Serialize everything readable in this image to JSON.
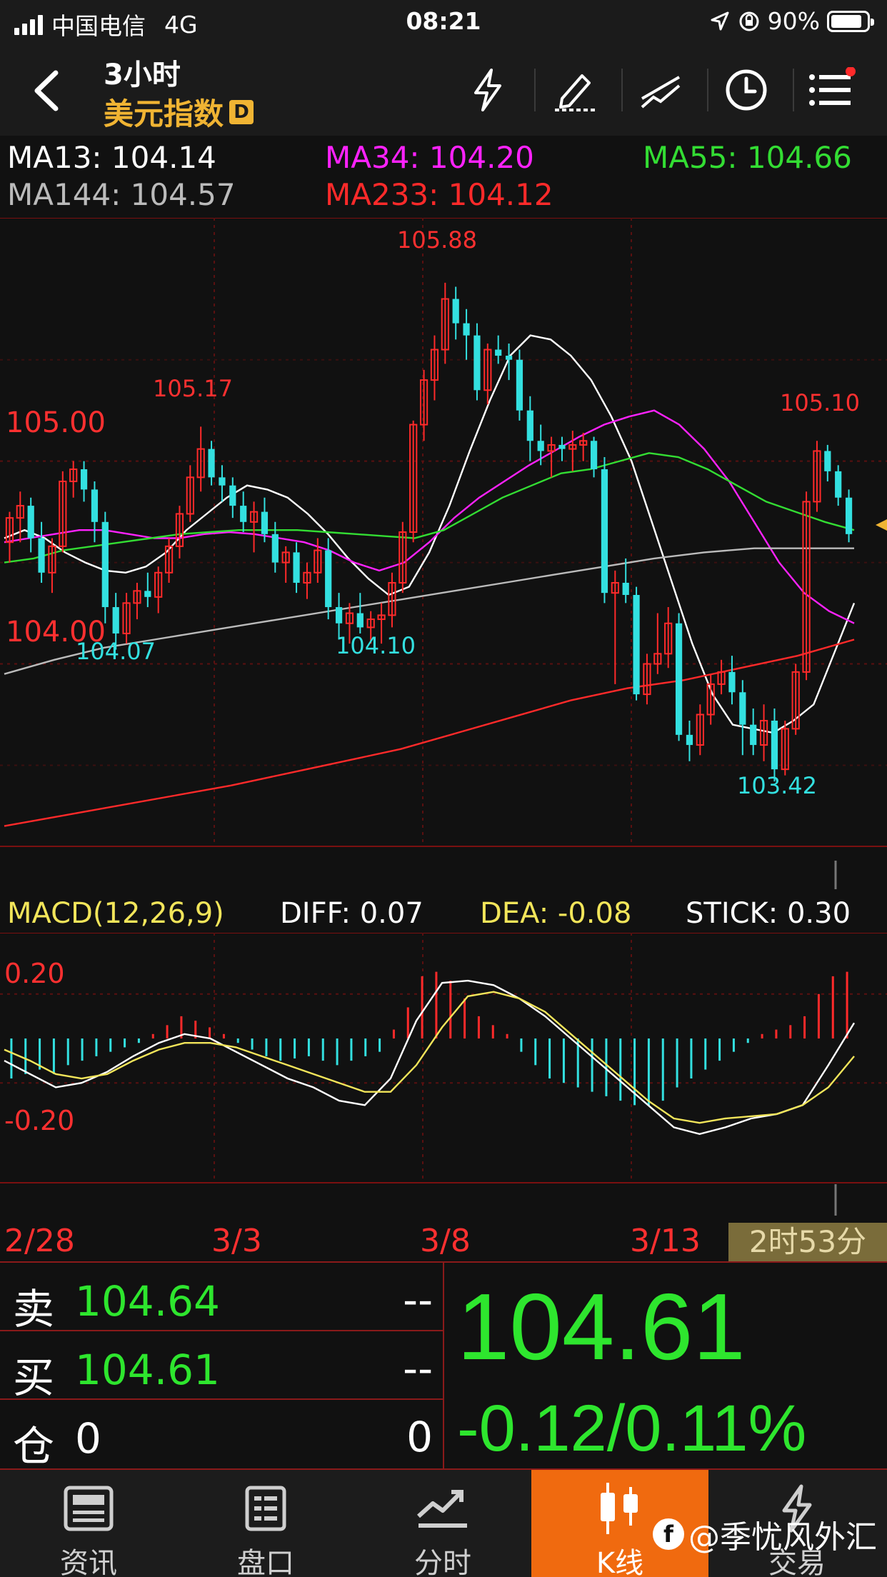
{
  "status_bar": {
    "carrier": "中国电信",
    "network": "4G",
    "time": "08:21",
    "battery": "90%"
  },
  "header": {
    "title": "3小时",
    "subtitle": "美元指数",
    "badge": "D"
  },
  "ma": {
    "ma13": "MA13: 104.14",
    "ma34": "MA34: 104.20",
    "ma55": "MA55: 104.66",
    "ma144": "MA144: 104.57",
    "ma233": "MA233: 104.12",
    "colors": {
      "ma13": "#ffffff",
      "ma34": "#ff22ff",
      "ma55": "#33dd33",
      "ma144": "#bbbbbb",
      "ma233": "#ff2a2a"
    }
  },
  "price_labels": {
    "p105_00": "105.00",
    "p104_00": "104.00",
    "high1": "105.17",
    "high2": "105.88",
    "high3": "105.10",
    "low1": "104.07",
    "low2": "104.10",
    "low3": "103.42"
  },
  "macd": {
    "title": "MACD(12,26,9)",
    "diff": "DIFF: 0.07",
    "dea": "DEA: -0.08",
    "stick": "STICK: 0.30",
    "upper": "0.20",
    "lower": "-0.20"
  },
  "x_axis": {
    "d1": "2/28",
    "d2": "3/3",
    "d3": "3/8",
    "d4": "3/13",
    "countdown": "2时53分"
  },
  "quote": {
    "sell_label": "卖",
    "sell_value": "104.64",
    "sell_vol": "--",
    "buy_label": "买",
    "buy_value": "104.61",
    "buy_vol": "--",
    "pos_label": "仓",
    "pos_value": "0",
    "pos_vol": "0",
    "last": "104.61",
    "change": "-0.12/0.11%"
  },
  "nav": {
    "news": "资讯",
    "board": "盘口",
    "timeshare": "分时",
    "kline": "K线",
    "trade": "交易"
  },
  "watermark": "@季忧风外汇",
  "chart_data": {
    "type": "candlestick",
    "symbol": "美元指数",
    "interval": "3小时",
    "x_ticks": [
      "2/28",
      "3/3",
      "3/8",
      "3/13"
    ],
    "y_ticks": [
      104.0,
      105.0
    ],
    "ylim": [
      103.1,
      106.2
    ],
    "annotated_extremes": [
      {
        "label": "105.17",
        "value": 105.17,
        "kind": "high"
      },
      {
        "label": "104.07",
        "value": 104.07,
        "kind": "low"
      },
      {
        "label": "104.10",
        "value": 104.1,
        "kind": "low"
      },
      {
        "label": "105.88",
        "value": 105.88,
        "kind": "high"
      },
      {
        "label": "103.42",
        "value": 103.42,
        "kind": "low"
      },
      {
        "label": "105.10",
        "value": 105.1,
        "kind": "high"
      }
    ],
    "candles": [
      [
        104.6,
        104.75,
        104.5,
        104.72
      ],
      [
        104.72,
        104.85,
        104.6,
        104.78
      ],
      [
        104.78,
        104.82,
        104.55,
        104.62
      ],
      [
        104.62,
        104.7,
        104.4,
        104.45
      ],
      [
        104.45,
        104.62,
        104.35,
        104.58
      ],
      [
        104.58,
        104.95,
        104.55,
        104.9
      ],
      [
        104.9,
        105.0,
        104.82,
        104.96
      ],
      [
        104.96,
        105.0,
        104.8,
        104.86
      ],
      [
        104.86,
        104.9,
        104.6,
        104.7
      ],
      [
        104.7,
        104.75,
        104.2,
        104.28
      ],
      [
        104.28,
        104.35,
        104.07,
        104.15
      ],
      [
        104.15,
        104.35,
        104.1,
        104.3
      ],
      [
        104.3,
        104.4,
        104.22,
        104.36
      ],
      [
        104.36,
        104.45,
        104.28,
        104.33
      ],
      [
        104.33,
        104.48,
        104.25,
        104.45
      ],
      [
        104.45,
        104.62,
        104.4,
        104.58
      ],
      [
        104.58,
        104.78,
        104.52,
        104.74
      ],
      [
        104.74,
        104.98,
        104.7,
        104.92
      ],
      [
        104.92,
        105.17,
        104.85,
        105.06
      ],
      [
        105.06,
        105.1,
        104.88,
        104.92
      ],
      [
        104.92,
        104.98,
        104.8,
        104.88
      ],
      [
        104.88,
        104.92,
        104.72,
        104.78
      ],
      [
        104.78,
        104.85,
        104.65,
        104.7
      ],
      [
        104.7,
        104.8,
        104.55,
        104.75
      ],
      [
        104.75,
        104.82,
        104.6,
        104.64
      ],
      [
        104.64,
        104.7,
        104.45,
        104.5
      ],
      [
        104.5,
        104.58,
        104.4,
        104.55
      ],
      [
        104.55,
        104.6,
        104.35,
        104.4
      ],
      [
        104.4,
        104.5,
        104.32,
        104.45
      ],
      [
        104.45,
        104.62,
        104.4,
        104.56
      ],
      [
        104.56,
        104.62,
        104.22,
        104.28
      ],
      [
        104.28,
        104.35,
        104.12,
        104.2
      ],
      [
        104.2,
        104.3,
        104.1,
        104.25
      ],
      [
        104.25,
        104.35,
        104.15,
        104.18
      ],
      [
        104.18,
        104.26,
        104.1,
        104.22
      ],
      [
        104.22,
        104.3,
        104.1,
        104.24
      ],
      [
        104.24,
        104.45,
        104.18,
        104.4
      ],
      [
        104.4,
        104.7,
        104.35,
        104.65
      ],
      [
        104.65,
        105.2,
        104.6,
        105.18
      ],
      [
        105.18,
        105.45,
        105.1,
        105.4
      ],
      [
        105.4,
        105.62,
        105.3,
        105.55
      ],
      [
        105.55,
        105.88,
        105.48,
        105.8
      ],
      [
        105.8,
        105.86,
        105.6,
        105.68
      ],
      [
        105.68,
        105.75,
        105.5,
        105.62
      ],
      [
        105.62,
        105.68,
        105.3,
        105.35
      ],
      [
        105.35,
        105.58,
        105.28,
        105.55
      ],
      [
        105.55,
        105.62,
        105.48,
        105.52
      ],
      [
        105.52,
        105.58,
        105.4,
        105.5
      ],
      [
        105.5,
        105.55,
        105.2,
        105.25
      ],
      [
        105.25,
        105.32,
        105.0,
        105.1
      ],
      [
        105.1,
        105.18,
        104.98,
        105.05
      ],
      [
        105.05,
        105.12,
        104.92,
        105.08
      ],
      [
        105.08,
        105.12,
        105.0,
        105.06
      ],
      [
        105.06,
        105.15,
        104.95,
        105.08
      ],
      [
        105.08,
        105.14,
        105.0,
        105.1
      ],
      [
        105.1,
        105.12,
        104.92,
        104.96
      ],
      [
        104.96,
        105.02,
        104.3,
        104.35
      ],
      [
        104.35,
        104.46,
        103.9,
        104.4
      ],
      [
        104.4,
        104.52,
        104.3,
        104.34
      ],
      [
        104.34,
        104.38,
        103.82,
        103.85
      ],
      [
        103.85,
        104.05,
        103.8,
        104.0
      ],
      [
        104.0,
        104.25,
        103.95,
        104.05
      ],
      [
        104.05,
        104.28,
        103.98,
        104.2
      ],
      [
        104.2,
        104.25,
        103.62,
        103.65
      ],
      [
        103.65,
        103.72,
        103.52,
        103.6
      ],
      [
        103.6,
        103.8,
        103.55,
        103.75
      ],
      [
        103.75,
        103.95,
        103.7,
        103.9
      ],
      [
        103.9,
        104.02,
        103.85,
        103.96
      ],
      [
        103.96,
        104.04,
        103.8,
        103.86
      ],
      [
        103.86,
        103.92,
        103.55,
        103.7
      ],
      [
        103.7,
        103.78,
        103.55,
        103.6
      ],
      [
        103.6,
        103.8,
        103.52,
        103.72
      ],
      [
        103.72,
        103.78,
        103.42,
        103.48
      ],
      [
        103.48,
        103.72,
        103.45,
        103.68
      ],
      [
        103.68,
        104.0,
        103.65,
        103.96
      ],
      [
        103.96,
        104.85,
        103.92,
        104.8
      ],
      [
        104.8,
        105.1,
        104.75,
        105.05
      ],
      [
        105.05,
        105.08,
        104.9,
        104.95
      ],
      [
        104.95,
        104.98,
        104.78,
        104.82
      ],
      [
        104.82,
        104.86,
        104.6,
        104.64
      ]
    ],
    "ma_lines": {
      "MA13": [
        104.62,
        104.66,
        104.62,
        104.55,
        104.5,
        104.46,
        104.45,
        104.48,
        104.55,
        104.66,
        104.74,
        104.82,
        104.88,
        104.86,
        104.82,
        104.74,
        104.64,
        104.52,
        104.42,
        104.34,
        104.38,
        104.55,
        104.78,
        105.05,
        105.3,
        105.52,
        105.62,
        105.6,
        105.52,
        105.4,
        105.22,
        105.0,
        104.7,
        104.4,
        104.1,
        103.85,
        103.7,
        103.68,
        103.66,
        103.72,
        103.8,
        104.05,
        104.3
      ],
      "MA34": [
        104.6,
        104.62,
        104.64,
        104.66,
        104.66,
        104.64,
        104.62,
        104.62,
        104.64,
        104.65,
        104.64,
        104.62,
        104.6,
        104.56,
        104.5,
        104.46,
        104.5,
        104.6,
        104.72,
        104.82,
        104.9,
        104.98,
        105.05,
        105.12,
        105.18,
        105.22,
        105.25,
        105.18,
        105.06,
        104.9,
        104.7,
        104.5,
        104.35,
        104.26,
        104.2
      ],
      "MA55": [
        104.5,
        104.52,
        104.56,
        104.58,
        104.6,
        104.62,
        104.64,
        104.65,
        104.66,
        104.66,
        104.66,
        104.65,
        104.64,
        104.63,
        104.62,
        104.66,
        104.74,
        104.82,
        104.88,
        104.94,
        104.96,
        105.0,
        105.04,
        105.02,
        104.96,
        104.88,
        104.8,
        104.75,
        104.7,
        104.66
      ],
      "MA144": [
        103.95,
        104.02,
        104.08,
        104.12,
        104.16,
        104.2,
        104.24,
        104.28,
        104.32,
        104.36,
        104.4,
        104.44,
        104.48,
        104.52,
        104.55,
        104.57,
        104.57,
        104.57
      ],
      "MA233": [
        103.2,
        103.25,
        103.3,
        103.35,
        103.4,
        103.46,
        103.52,
        103.58,
        103.66,
        103.74,
        103.82,
        103.88,
        103.92,
        103.98,
        104.04,
        104.12
      ]
    },
    "macd_scale": [
      -0.45,
      0.45
    ],
    "macd_diff": [
      -0.1,
      -0.16,
      -0.22,
      -0.2,
      -0.15,
      -0.08,
      -0.02,
      0.02,
      0.0,
      -0.06,
      -0.12,
      -0.18,
      -0.22,
      -0.28,
      -0.3,
      -0.18,
      0.08,
      0.25,
      0.26,
      0.24,
      0.18,
      0.1,
      0.0,
      -0.1,
      -0.2,
      -0.3,
      -0.4,
      -0.43,
      -0.4,
      -0.36,
      -0.34,
      -0.3,
      -0.12,
      0.07
    ],
    "macd_dea": [
      -0.05,
      -0.1,
      -0.16,
      -0.18,
      -0.16,
      -0.1,
      -0.05,
      -0.02,
      -0.02,
      -0.04,
      -0.08,
      -0.12,
      -0.16,
      -0.2,
      -0.24,
      -0.24,
      -0.12,
      0.05,
      0.19,
      0.21,
      0.18,
      0.12,
      0.02,
      -0.08,
      -0.18,
      -0.28,
      -0.36,
      -0.38,
      -0.36,
      -0.35,
      -0.34,
      -0.3,
      -0.22,
      -0.08
    ],
    "macd_stick": [
      -0.18,
      -0.16,
      -0.14,
      -0.16,
      -0.12,
      -0.1,
      -0.08,
      -0.06,
      -0.04,
      -0.02,
      0.02,
      0.06,
      0.1,
      0.08,
      0.05,
      0.02,
      -0.02,
      -0.05,
      -0.08,
      -0.1,
      -0.09,
      -0.08,
      -0.1,
      -0.12,
      -0.1,
      -0.08,
      -0.06,
      0.04,
      0.14,
      0.28,
      0.3,
      0.26,
      0.18,
      0.1,
      0.06,
      0.02,
      -0.06,
      -0.12,
      -0.18,
      -0.2,
      -0.22,
      -0.24,
      -0.26,
      -0.28,
      -0.3,
      -0.3,
      -0.28,
      -0.22,
      -0.18,
      -0.14,
      -0.1,
      -0.06,
      -0.02,
      0.02,
      0.04,
      0.06,
      0.1,
      0.2,
      0.28,
      0.3
    ]
  }
}
